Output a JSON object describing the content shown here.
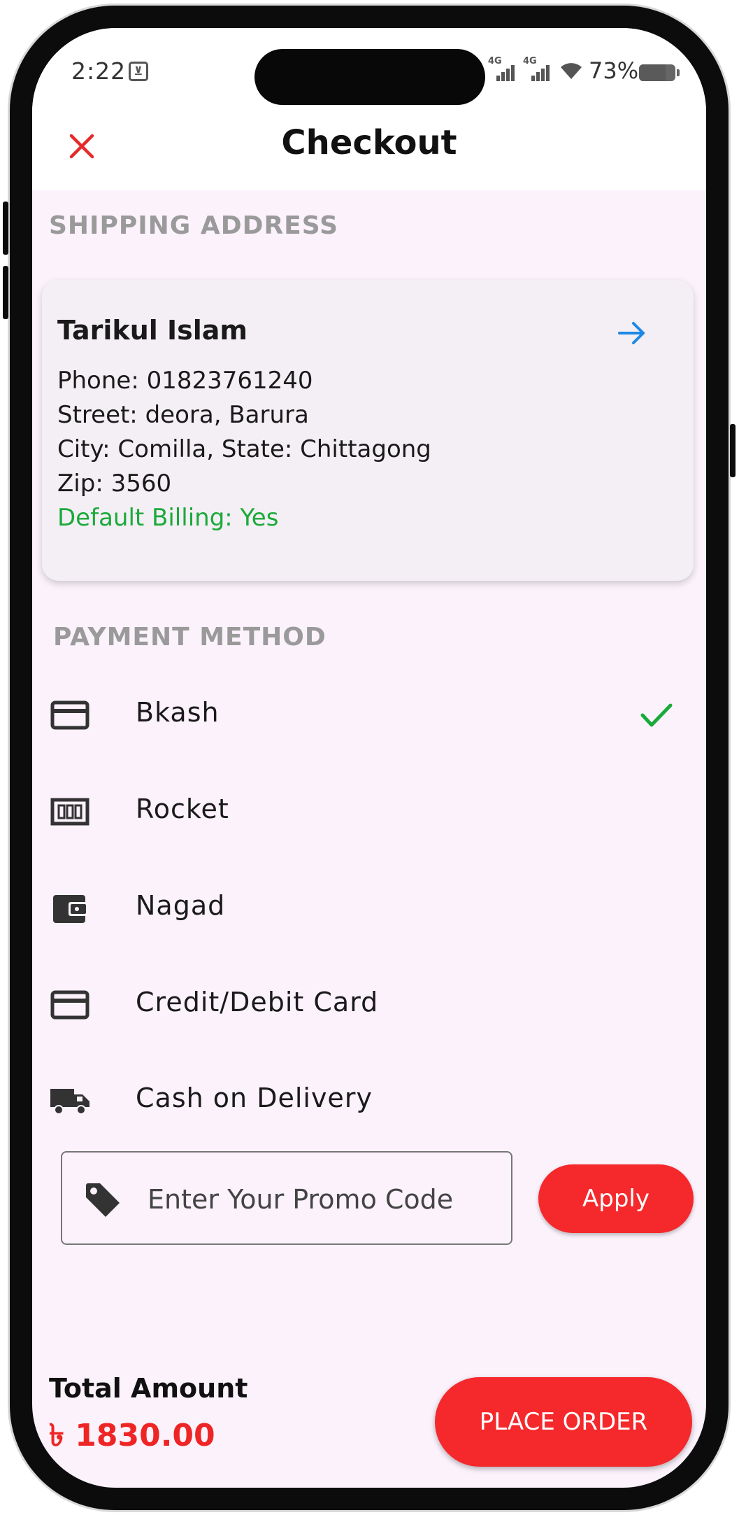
{
  "status_bar": {
    "time": "2:22",
    "battery_percent": "73%",
    "battery_level": 0.73,
    "network_labels": [
      "4G",
      "4G"
    ]
  },
  "header": {
    "title": "Checkout",
    "close_icon": "close-icon",
    "close_color": "#e52a2a"
  },
  "shipping": {
    "section_label": "SHIPPING ADDRESS",
    "name": "Tarikul Islam",
    "phone": "Phone: 01823761240",
    "street": "Street: deora, Barura",
    "city_state": "City: Comilla, State: Chittagong",
    "zip": "Zip: 3560",
    "default_billing": "Default Billing: Yes",
    "arrow_icon": "arrow-right-icon",
    "arrow_color": "#1e88e5"
  },
  "payment": {
    "section_label": "PAYMENT METHOD",
    "methods": [
      {
        "label": "Bkash",
        "icon": "credit-card-icon",
        "selected": true
      },
      {
        "label": "Rocket",
        "icon": "money-icon",
        "selected": false
      },
      {
        "label": "Nagad",
        "icon": "wallet-icon",
        "selected": false
      },
      {
        "label": "Credit/Debit Card",
        "icon": "credit-card-icon",
        "selected": false
      },
      {
        "label": "Cash on Delivery",
        "icon": "truck-icon",
        "selected": false
      }
    ],
    "check_color": "#1aaa3a"
  },
  "promo": {
    "placeholder": "Enter Your Promo Code",
    "apply_label": "Apply",
    "icon": "tag-icon"
  },
  "footer": {
    "total_label": "Total Amount",
    "total_value": "৳ 1830.00",
    "place_order_label": "PLACE ORDER"
  },
  "colors": {
    "accent": "#f5282b",
    "background": "#fbf2fb",
    "success": "#1aaa3a"
  }
}
